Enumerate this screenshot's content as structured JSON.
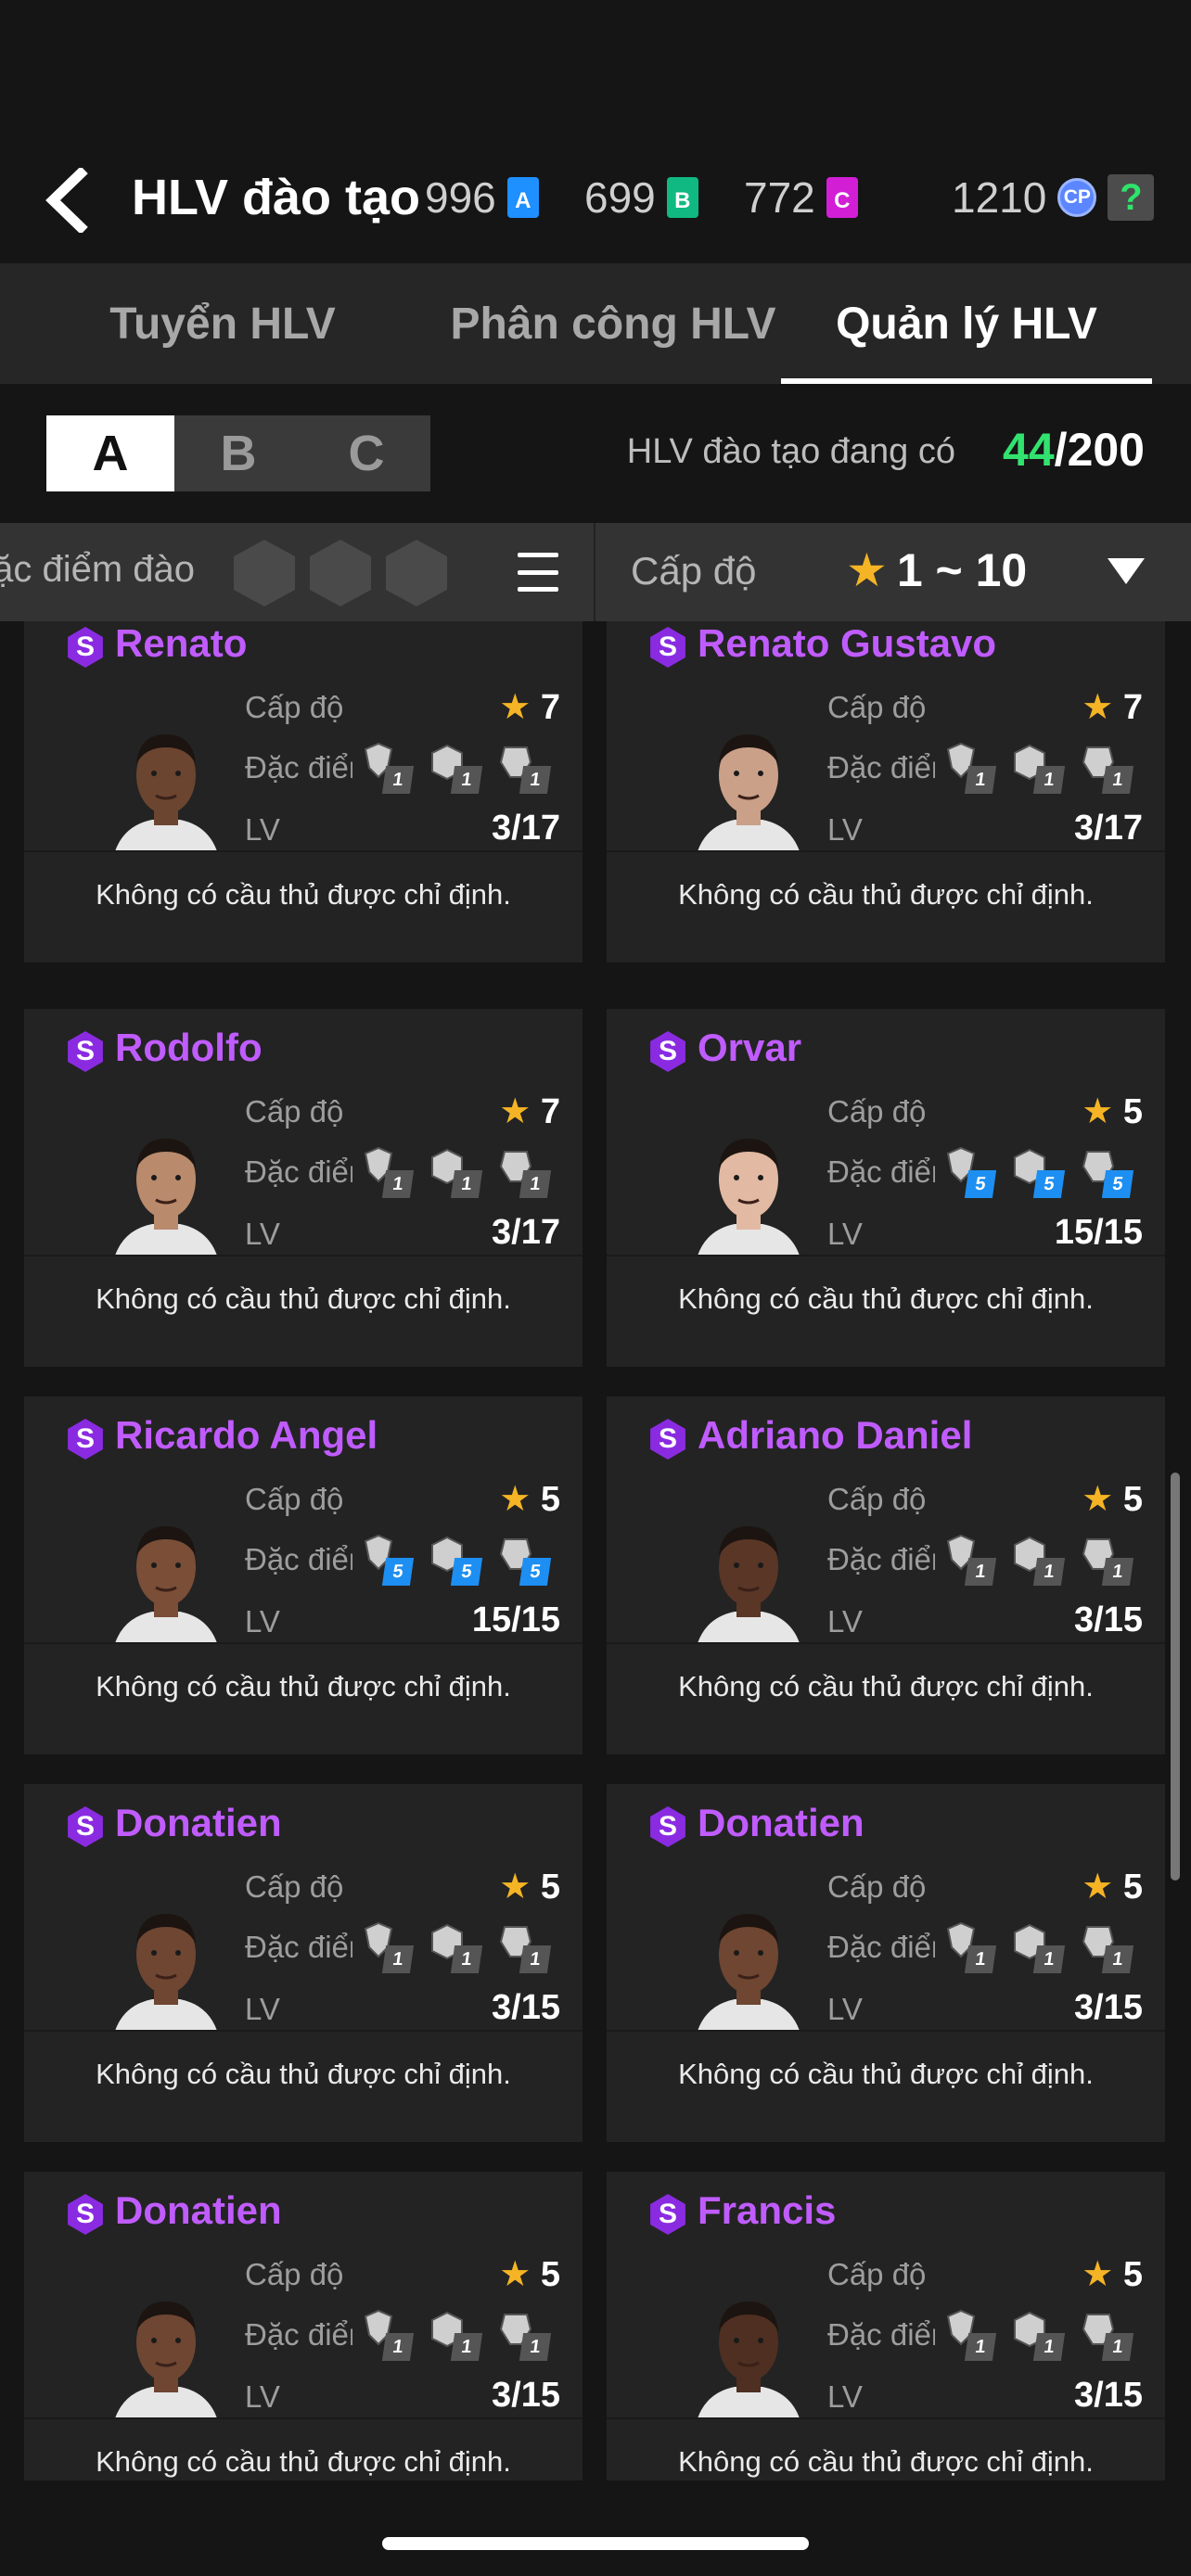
{
  "header": {
    "title": "HLV đào tạo",
    "currencies": [
      {
        "value": "996",
        "badge": "A",
        "color": "#1e90ff"
      },
      {
        "value": "699",
        "badge": "B",
        "color": "#10b981"
      },
      {
        "value": "772",
        "badge": "C",
        "color": "#d21fd6"
      }
    ],
    "cp": {
      "value": "1210",
      "badge": "CP"
    },
    "help": "?"
  },
  "tabs": [
    {
      "label": "Tuyển HLV",
      "active": false
    },
    {
      "label": "Phân công HLV",
      "active": false
    },
    {
      "label": "Quản lý HLV",
      "active": true
    }
  ],
  "groups": [
    "A",
    "B",
    "C"
  ],
  "active_group": "A",
  "roster": {
    "label": "HLV đào tạo đang có",
    "current": "44",
    "max": "/200"
  },
  "filter": {
    "trait_label": "Đặc điểm đào",
    "level_label": "Cấp độ",
    "level_range": "1 ~ 10"
  },
  "labels": {
    "level": "Cấp độ",
    "trait": "Đặc điểm",
    "lv": "LV"
  },
  "coaches": [
    {
      "name": "Renato",
      "stars": "7",
      "lv": "3/17",
      "traits": [
        "1",
        "1",
        "1"
      ],
      "boost": false,
      "skin": "#6b4530",
      "note": "Không có cầu thủ được chỉ định."
    },
    {
      "name": "Renato Gustavo",
      "stars": "7",
      "lv": "3/17",
      "traits": [
        "1",
        "1",
        "1"
      ],
      "boost": false,
      "skin": "#caa089",
      "note": "Không có cầu thủ được chỉ định."
    },
    {
      "name": "Rodolfo",
      "stars": "7",
      "lv": "3/17",
      "traits": [
        "1",
        "1",
        "1"
      ],
      "boost": false,
      "skin": "#b98a6c",
      "note": "Không có cầu thủ được chỉ định."
    },
    {
      "name": "Orvar",
      "stars": "5",
      "lv": "15/15",
      "traits": [
        "5",
        "5",
        "5"
      ],
      "boost": true,
      "skin": "#e2b9a2",
      "note": "Không có cầu thủ được chỉ định."
    },
    {
      "name": "Ricardo Angel",
      "stars": "5",
      "lv": "15/15",
      "traits": [
        "5",
        "5",
        "5"
      ],
      "boost": true,
      "skin": "#7a4e37",
      "note": "Không có cầu thủ được chỉ định."
    },
    {
      "name": "Adriano Daniel",
      "stars": "5",
      "lv": "3/15",
      "traits": [
        "1",
        "1",
        "1"
      ],
      "boost": false,
      "skin": "#5a3626",
      "note": "Không có cầu thủ được chỉ định."
    },
    {
      "name": "Donatien",
      "stars": "5",
      "lv": "3/15",
      "traits": [
        "1",
        "1",
        "1"
      ],
      "boost": false,
      "skin": "#6e4632",
      "note": "Không có cầu thủ được chỉ định."
    },
    {
      "name": "Donatien",
      "stars": "5",
      "lv": "3/15",
      "traits": [
        "1",
        "1",
        "1"
      ],
      "boost": false,
      "skin": "#6e4632",
      "note": "Không có cầu thủ được chỉ định."
    },
    {
      "name": "Donatien",
      "stars": "5",
      "lv": "3/15",
      "traits": [
        "1",
        "1",
        "1"
      ],
      "boost": false,
      "skin": "#6e4632",
      "note": "Không có cầu thủ được chỉ định."
    },
    {
      "name": "Francis",
      "stars": "5",
      "lv": "3/15",
      "traits": [
        "1",
        "1",
        "1"
      ],
      "boost": false,
      "skin": "#4e2f21",
      "note": "Không có cầu thủ được chỉ định."
    }
  ]
}
